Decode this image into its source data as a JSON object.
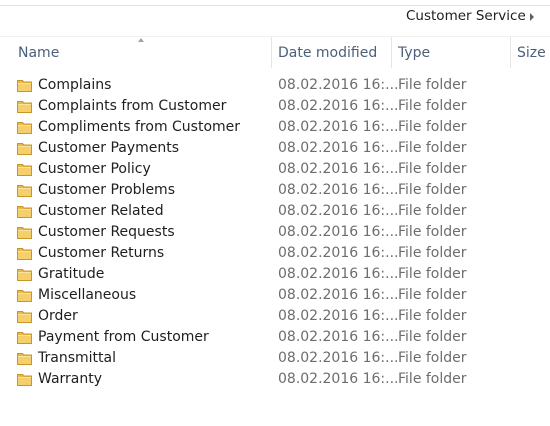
{
  "breadcrumb": {
    "current": "Customer Service"
  },
  "columns": {
    "name": "Name",
    "date_modified": "Date modified",
    "type": "Type",
    "size": "Size"
  },
  "files": [
    {
      "name": "Complains",
      "date": "08.02.2016 16:...",
      "type": "File folder"
    },
    {
      "name": "Complaints from Customer",
      "date": "08.02.2016 16:...",
      "type": "File folder"
    },
    {
      "name": "Compliments from Customer",
      "date": "08.02.2016 16:...",
      "type": "File folder"
    },
    {
      "name": "Customer Payments",
      "date": "08.02.2016 16:...",
      "type": "File folder"
    },
    {
      "name": "Customer Policy",
      "date": "08.02.2016 16:...",
      "type": "File folder"
    },
    {
      "name": "Customer Problems",
      "date": "08.02.2016 16:...",
      "type": "File folder"
    },
    {
      "name": "Customer Related",
      "date": "08.02.2016 16:...",
      "type": "File folder"
    },
    {
      "name": "Customer Requests",
      "date": "08.02.2016 16:...",
      "type": "File folder"
    },
    {
      "name": "Customer Returns",
      "date": "08.02.2016 16:...",
      "type": "File folder"
    },
    {
      "name": "Gratitude",
      "date": "08.02.2016 16:...",
      "type": "File folder"
    },
    {
      "name": "Miscellaneous",
      "date": "08.02.2016 16:...",
      "type": "File folder"
    },
    {
      "name": "Order",
      "date": "08.02.2016 16:...",
      "type": "File folder"
    },
    {
      "name": "Payment from Customer",
      "date": "08.02.2016 16:...",
      "type": "File folder"
    },
    {
      "name": "Transmittal",
      "date": "08.02.2016 16:...",
      "type": "File folder"
    },
    {
      "name": "Warranty",
      "date": "08.02.2016 16:...",
      "type": "File folder"
    }
  ],
  "icons": {
    "folder": "folder-icon",
    "sort": "sort-ascending-icon",
    "breadcrumb_chevron": "chevron-right-icon"
  },
  "colors": {
    "header_text": "#4c607a",
    "folder_yellow": "#e8b84a",
    "secondary_text": "#6d6d6d"
  }
}
